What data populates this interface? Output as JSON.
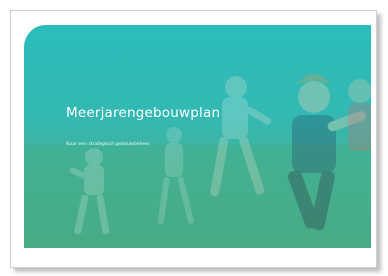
{
  "document": {
    "title": "Meerjarengebouwplan",
    "subtitle": "Naar een strategisch gebouwbeheer"
  },
  "colors": {
    "cover_overlay": "#2bbcbc",
    "brand_bar": [
      "#f5c400",
      "#e5007d",
      "#3a2a8c",
      "#e5007d",
      "#f5c400"
    ]
  },
  "image": {
    "description": "children-running-in-field-photo"
  }
}
